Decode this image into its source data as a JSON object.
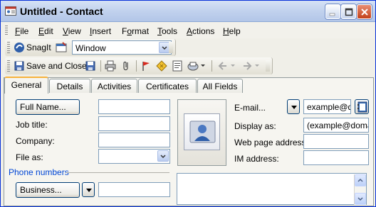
{
  "window": {
    "title": "Untitled - Contact",
    "controls": [
      "minimize",
      "maximize",
      "close"
    ]
  },
  "menu": [
    {
      "label": "File",
      "key": "F",
      "rest": "ile"
    },
    {
      "label": "Edit",
      "key": "E",
      "rest": "dit"
    },
    {
      "label": "View",
      "key": "V",
      "rest": "iew"
    },
    {
      "label": "Insert",
      "key": "I",
      "rest": "nsert"
    },
    {
      "label": "Format",
      "key": "o",
      "pre": "F",
      "rest": "rmat"
    },
    {
      "label": "Tools",
      "key": "T",
      "rest": "ools"
    },
    {
      "label": "Actions",
      "key": "A",
      "rest": "ctions"
    },
    {
      "label": "Help",
      "key": "H",
      "rest": "elp"
    }
  ],
  "snagit_toolbar": {
    "snagit_label": "SnagIt",
    "capture_mode": "Window"
  },
  "standard_toolbar": {
    "save_close_label": "Save and Close",
    "icons": [
      "save-icon",
      "print-icon",
      "attach-icon",
      "flag-icon",
      "categories-icon",
      "details-icon",
      "options-icon",
      "previous-icon",
      "next-icon"
    ]
  },
  "tabs": [
    "General",
    "Details",
    "Activities",
    "Certificates",
    "All Fields"
  ],
  "active_tab": "General",
  "form": {
    "full_name_button": "Full Name...",
    "job_title_label": "Job title:",
    "company_label": "Company:",
    "file_as_label": "File as:",
    "phone_numbers_section": "Phone numbers",
    "business_button": "Business...",
    "email_label": "E-mail...",
    "email_value": "example@do",
    "display_as_label": "Display as:",
    "display_as_value": "(example@domair",
    "web_page_label": "Web page address:",
    "im_address_label": "IM address:",
    "full_name_value": "",
    "job_title_value": "",
    "company_value": "",
    "file_as_value": "",
    "business_phone_value": "",
    "web_page_value": "",
    "im_address_value": ""
  },
  "colors": {
    "titlebar": "#c3d3ee",
    "active_tab_accent": "#f7b23b",
    "input_border": "#7f9db9",
    "section_label": "#0046d5"
  }
}
